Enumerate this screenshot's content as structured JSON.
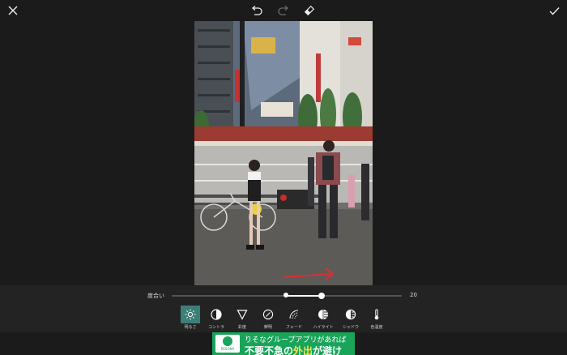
{
  "toolbar": {
    "close_icon": "close-icon",
    "undo_icon": "undo-icon",
    "redo_icon": "redo-icon",
    "eraser_icon": "eraser-icon",
    "confirm_icon": "check-icon"
  },
  "slider": {
    "label": "度合い",
    "value": "20",
    "value_fraction": 0.2
  },
  "tools": [
    {
      "label": "明るさ",
      "icon": "brightness-icon",
      "active": true
    },
    {
      "label": "コントラ",
      "icon": "contrast-icon",
      "active": false
    },
    {
      "label": "彩度",
      "icon": "saturation-icon",
      "active": false
    },
    {
      "label": "鮮明",
      "icon": "clarity-icon",
      "active": false
    },
    {
      "label": "フェード",
      "icon": "fade-icon",
      "active": false
    },
    {
      "label": "ハイライト",
      "icon": "highlight-icon",
      "active": false
    },
    {
      "label": "シャドウ",
      "icon": "shadow-icon",
      "active": false
    },
    {
      "label": "色温度",
      "icon": "temperature-icon",
      "active": false
    }
  ],
  "ad": {
    "logo_text": "RESONA",
    "line1": "りそなグループアプリがあれば",
    "line2_a": "不要不急の",
    "line2_hl": "外出",
    "line2_b": "が避け"
  },
  "colors": {
    "background": "#1b1b1b",
    "accent_active_tool": "#3a7f78",
    "annotation_arrow": "#d93030",
    "ad_green": "#19a45a"
  }
}
